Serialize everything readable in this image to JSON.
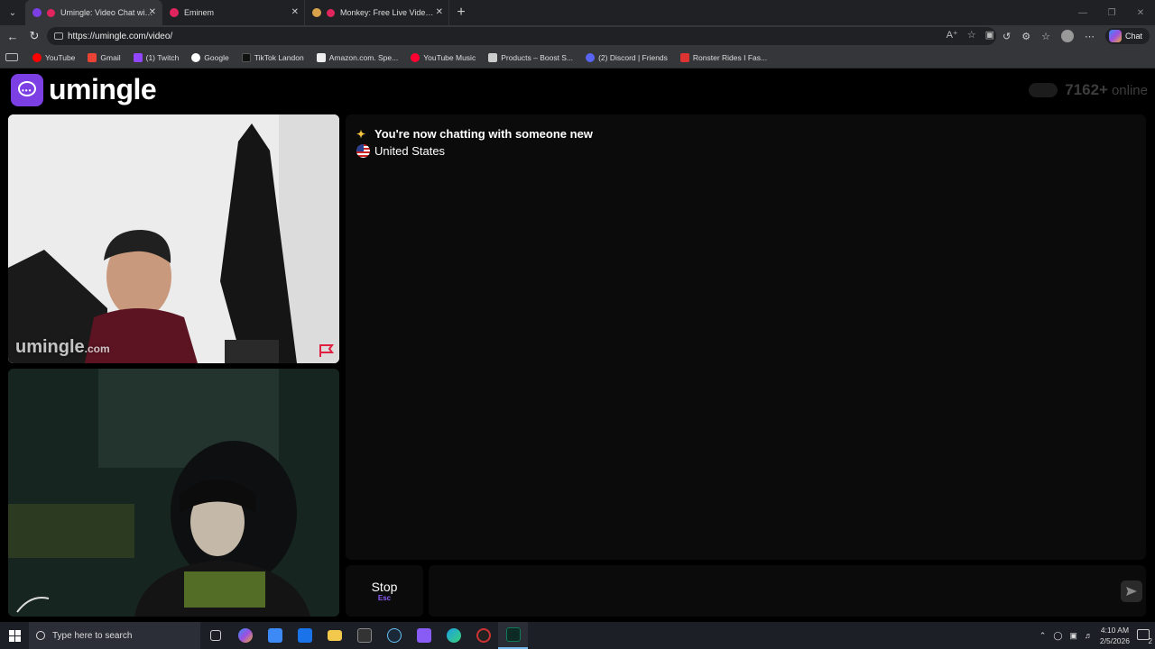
{
  "browser": {
    "tabs": [
      {
        "title": "Umingle: Video Chat with Stra",
        "fav_color": "#7b3fe4",
        "active": true
      },
      {
        "title": "Eminem",
        "fav_color": "#e0245e",
        "active": false
      },
      {
        "title": "Monkey: Free Live Video Chat",
        "fav_color": "#d8a14a",
        "active": false
      }
    ],
    "url": "https://umingle.com/video/",
    "copilot_label": "Chat",
    "bookmarks": [
      {
        "label": "YouTube",
        "color": "#ff0000"
      },
      {
        "label": "Gmail",
        "color": "#ea4335"
      },
      {
        "label": "(1) Twitch",
        "color": "#9146ff"
      },
      {
        "label": "Google",
        "color": "#4285f4"
      },
      {
        "label": "TikTok Landon",
        "color": "#111111"
      },
      {
        "label": "Amazon.com. Spe...",
        "color": "#eeeeee"
      },
      {
        "label": "YouTube Music",
        "color": "#ff0033"
      },
      {
        "label": "Products – Boost S...",
        "color": "#cccccc"
      },
      {
        "label": "(2) Discord | Friends",
        "color": "#5865f2"
      },
      {
        "label": "Ronster Rides I Fas...",
        "color": "#d33"
      }
    ]
  },
  "site": {
    "logo_text": "umingle",
    "online_count": "7162+",
    "online_label": "online",
    "brand_color": "#7b3fe4"
  },
  "video": {
    "watermark_main": "umingle",
    "watermark_suffix": ".com"
  },
  "chat": {
    "system_message": "You're now chatting with someone new",
    "country": "United States",
    "stop_label": "Stop",
    "stop_shortcut": "Esc",
    "input_placeholder": ""
  },
  "taskbar": {
    "search_placeholder": "Type here to search",
    "time": "4:10 AM",
    "date": "2/5/2026",
    "notification_count": "2",
    "apps": [
      {
        "name": "task-view-icon",
        "color": "#5a5f6a"
      },
      {
        "name": "copilot-icon",
        "color": "#6a7bf0"
      },
      {
        "name": "store-icon",
        "color": "#3d8af7"
      },
      {
        "name": "outlook-icon",
        "color": "#1a73e8"
      },
      {
        "name": "file-explorer-icon",
        "color": "#f2c94c"
      },
      {
        "name": "epic-games-icon",
        "color": "#333333"
      },
      {
        "name": "steam-icon",
        "color": "#1b2838"
      },
      {
        "name": "app-icon",
        "color": "#8a5cf6"
      },
      {
        "name": "edge-icon",
        "color": "#1ba1e2"
      },
      {
        "name": "app-2-icon",
        "color": "#cc3333"
      },
      {
        "name": "terminal-icon",
        "color": "#0e7a5a"
      }
    ]
  }
}
